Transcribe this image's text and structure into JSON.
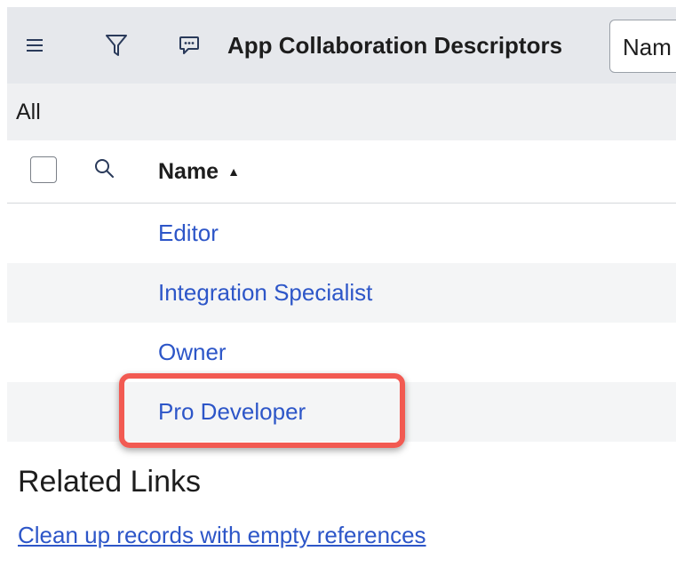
{
  "header": {
    "menu_icon": "hamburger-menu-icon",
    "filter_icon": "filter-funnel-icon",
    "chat_icon": "chat-bubble-icon",
    "title": "App Collaboration Descriptors",
    "search_field_value": "Nam"
  },
  "breadcrumb": {
    "label": "All"
  },
  "list": {
    "column_header": "Name",
    "sort_direction": "ascending",
    "search_icon": "magnifier-icon",
    "rows": [
      {
        "name": "Editor"
      },
      {
        "name": "Integration Specialist"
      },
      {
        "name": "Owner"
      },
      {
        "name": "Pro Developer"
      }
    ],
    "highlighted_row": "Pro Developer"
  },
  "related": {
    "title": "Related Links",
    "link": "Clean up records with empty references"
  },
  "colors": {
    "link": "#2d56c8",
    "highlight": "#f25a52",
    "header_bg": "#e6e8ec"
  }
}
